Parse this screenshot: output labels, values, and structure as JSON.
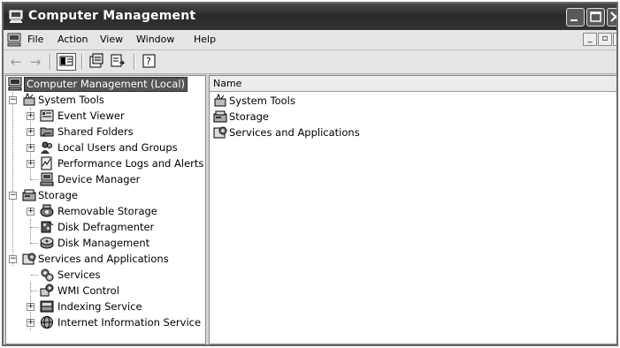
{
  "window": {
    "title": "Computer Management"
  },
  "menu": {
    "items": [
      "File",
      "Action",
      "View",
      "Window",
      "Help"
    ]
  },
  "toolbar": {
    "buttons": [
      "back-arrow-icon",
      "forward-arrow-icon",
      "show-hide-console-tree-icon",
      "properties-icon",
      "export-list-icon",
      "help-icon"
    ]
  },
  "tree": {
    "root": "Computer Management (Local)",
    "system_tools": "System Tools",
    "event_viewer": "Event Viewer",
    "shared_folders": "Shared Folders",
    "local_users": "Local Users and Groups",
    "perf_logs": "Performance Logs and Alerts",
    "device_manager": "Device Manager",
    "storage": "Storage",
    "removable_storage": "Removable Storage",
    "disk_defrag": "Disk Defragmenter",
    "disk_mgmt": "Disk Management",
    "services_apps": "Services and Applications",
    "services": "Services",
    "wmi": "WMI Control",
    "indexing": "Indexing Service",
    "iis": "Internet Information Service"
  },
  "list": {
    "column_name": "Name",
    "items": [
      "System Tools",
      "Storage",
      "Services and Applications"
    ]
  }
}
